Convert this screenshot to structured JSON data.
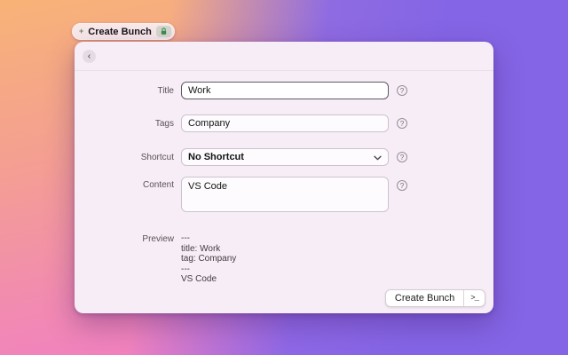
{
  "tab": {
    "label": "Create Bunch",
    "left_icon": "bunch-icon",
    "right_icon": "lock-icon"
  },
  "window": {
    "back_icon": "‹"
  },
  "form": {
    "title": {
      "label": "Title",
      "value": "Work"
    },
    "tags": {
      "label": "Tags",
      "value": "Company"
    },
    "shortcut": {
      "label": "Shortcut",
      "value": "No Shortcut"
    },
    "content": {
      "label": "Content",
      "value": "VS Code"
    },
    "preview": {
      "label": "Preview",
      "lines": [
        "---",
        "title: Work",
        "tag: Company",
        "---",
        "VS Code"
      ]
    }
  },
  "footer": {
    "create_button_label": "Create Bunch",
    "terminal_button_label": ">_"
  },
  "icons": {
    "help": "?",
    "bunch": "+"
  },
  "colors": {
    "gradient_top_left": "#f8b377",
    "gradient_bottom_left": "#f07cc7",
    "gradient_right": "#8465e5",
    "window_bg": "#f7edf6",
    "lock_green": "#3f8a4e",
    "focused_border": "#5e5a64"
  }
}
